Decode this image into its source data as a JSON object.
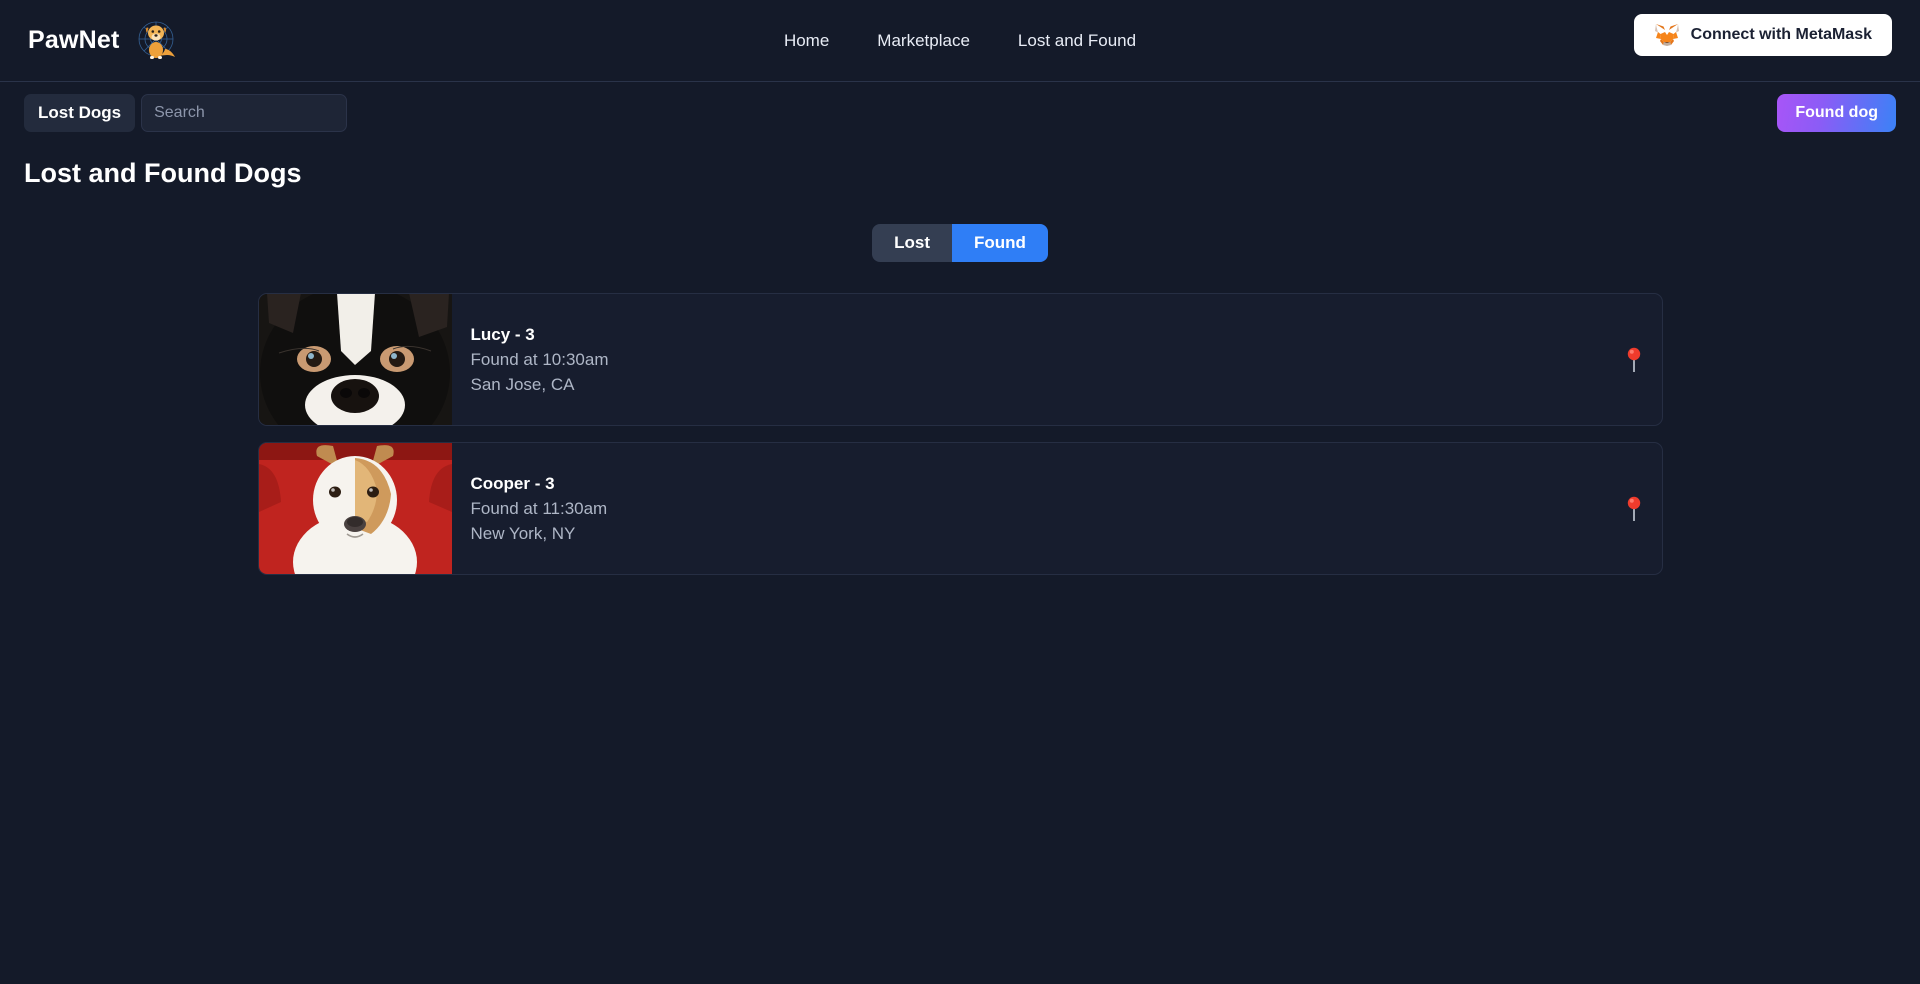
{
  "header": {
    "brand_name": "PawNet",
    "brand_logo_icon": "dog-network-logo",
    "nav": [
      {
        "label": "Home",
        "name": "nav-link-home"
      },
      {
        "label": "Marketplace",
        "name": "nav-link-marketplace"
      },
      {
        "label": "Lost and Found",
        "name": "nav-link-lost-and-found"
      }
    ],
    "connect_button": {
      "label": "Connect with MetaMask",
      "icon": "metamask-fox-icon",
      "bg_color": "#ffffff",
      "text_color": "#1b2133"
    }
  },
  "toolbar": {
    "lost_dogs_label": "Lost Dogs",
    "search_placeholder": "Search",
    "search_value": "",
    "found_dog_label": "Found dog",
    "found_dog_gradient_from": "#a855f7",
    "found_dog_gradient_to": "#3b82f6"
  },
  "main": {
    "page_title": "Lost and Found Dogs",
    "toggle": {
      "lost_label": "Lost",
      "found_label": "Found",
      "selected": "Found",
      "active_color": "#2f7ef6",
      "inactive_color": "#343e52"
    },
    "cards": [
      {
        "name": "Lucy - 3",
        "time": "Found at 10:30am",
        "location": "San Jose, CA",
        "photo": "boston-terrier-black-white-closeup",
        "pin_icon": "location-pin-icon"
      },
      {
        "name": "Cooper - 3",
        "time": "Found at 11:30am",
        "location": "New York, NY",
        "photo": "tan-white-dog-on-red-couch",
        "pin_icon": "location-pin-icon"
      }
    ]
  },
  "theme": {
    "background": "#141a29",
    "card_background": "#171d2e",
    "text_primary": "#ffffff",
    "text_secondary": "#aeb6c6"
  }
}
